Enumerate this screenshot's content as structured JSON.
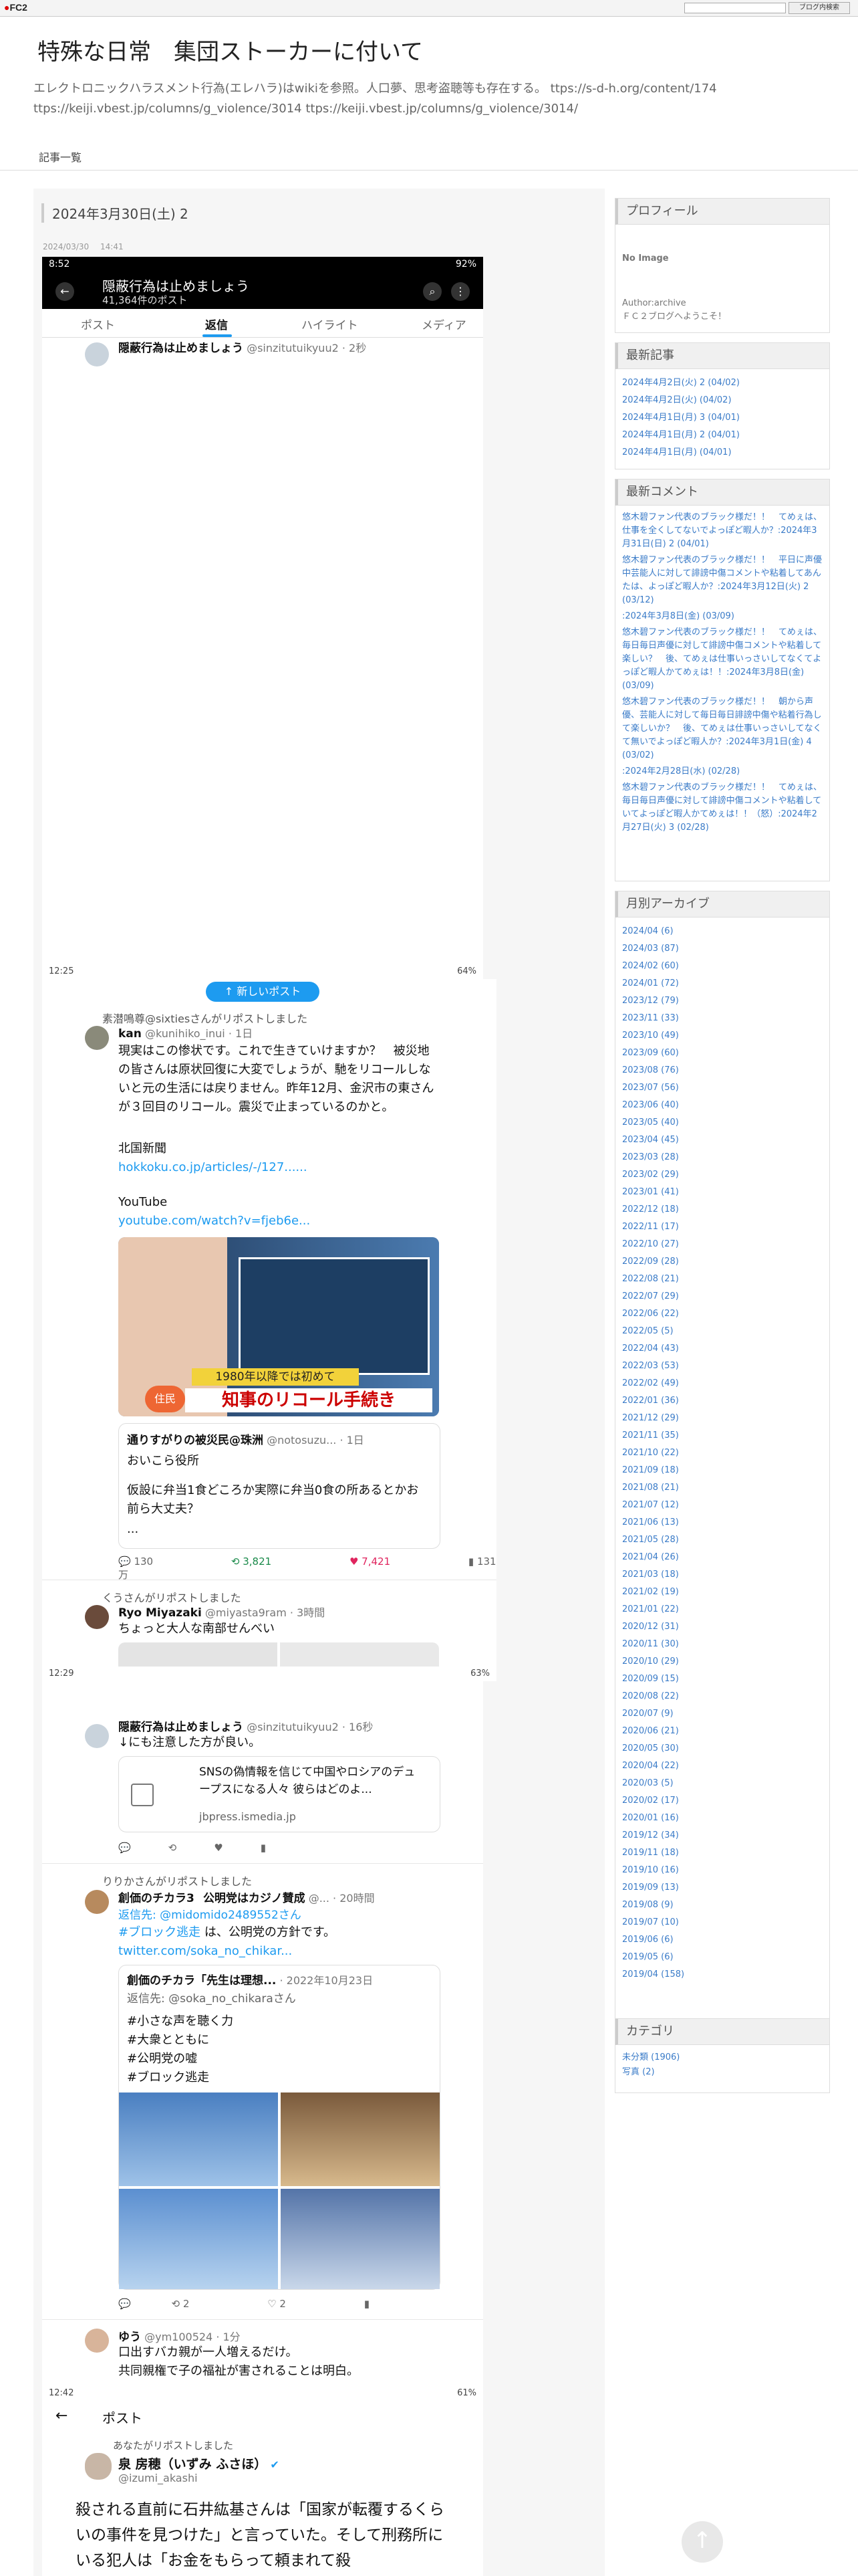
{
  "fc2": {
    "logo": "FC2",
    "blog_btn": "ブログ内検索"
  },
  "blog": {
    "title": "特殊な日常　集団ストーカーに付いて",
    "description": "エレクトロニックハラスメント行為(エレハラ)はwikiを参照。人口夢、思考盗聴等も存在する。 ttps://s-d-h.org/content/174 ttps://keiji.vbest.jp/columns/g_violence/3014 ttps://keiji.vbest.jp/columns/g_violence/3014/",
    "nav_link": "記事一覧"
  },
  "post": {
    "title": "2024年3月30日(土) 2",
    "date": "2024/03/30",
    "time": "14:41"
  },
  "shot1": {
    "status_time": "8:52",
    "status_right": "92%",
    "header_title": "隠蔽行為は止めましょう",
    "header_sub": "41,364件のポスト",
    "tabs": [
      "ポスト",
      "返信",
      "ハイライト",
      "メディア"
    ],
    "tweet_name": "隠蔽行為は止めましょう",
    "tweet_handle": "@sinzitutuikyuu2 · 2秒",
    "bottom_time": "12:25",
    "bottom_right": "64%",
    "new_post": "↑ 新しいポスト"
  },
  "shot2": {
    "rt1": "素潜鳴尊@sixtiesさんがリポストしました",
    "t1_name": "kan",
    "t1_handle": "@kunihiko_inui · 1日",
    "t1_text": "現実はこの惨状です。これで生きていけますか？　被災地の皆さんは原状回復に大変でしょうが、馳をリコールしないと元の生活には戻りません。昨年12月、金沢市の東さんが３回目のリコール。震災で止まっているのかと。",
    "t1_src": "北国新聞",
    "t1_link1": "hokkoku.co.jp/articles/-/127......",
    "t1_yt": "YouTube",
    "t1_link2": "youtube.com/watch?v=fjeb6e...",
    "media_caption1": "1980年以降では初めて",
    "media_caption2": "知事のリコール手続き",
    "media_tag": "住民",
    "quote_name": "通りすがりの被災民@珠洲",
    "quote_handle": "@notosuzu... · 1日",
    "quote_text1": "おいこら役所",
    "quote_text2": "仮設に弁当1食どころか実際に弁当0食の所あるとかお前ら大丈夫？",
    "quote_text3": "...",
    "t1_actions": [
      "130",
      "3,821",
      "7,421",
      "131万"
    ],
    "rt2": "くうさんがリポストしました",
    "t2_name": "Ryo Miyazaki",
    "t2_handle": "@miyasta9ram · 3時間",
    "t2_text": "ちょっと大人な南部せんべい",
    "bottom_time": "12:29",
    "bottom_right": "63%"
  },
  "shot3": {
    "t3_name": "隠蔽行為は止めましょう",
    "t3_handle": "@sinzitutuikyuu2 · 16秒",
    "t3_text": "↓にも注意した方が良い。",
    "card_text": "SNSの偽情報を信じて中国やロシアのデュープスになる人々 彼らはどのよ...",
    "card_domain": "jbpress.ismedia.jp",
    "rt3": "りりかさんがリポストしました",
    "t4_name": "創価のチカラ3",
    "t4_badge": "公明党はカジノ賛成",
    "t4_handle": "@... · 20時間",
    "t4_reply": "返信先: @midomido2489552さん",
    "t4_text_tag": "#ブロック逃走",
    "t4_text": " は、公明党の方針です。",
    "t4_link": "twitter.com/soka_no_chikar...",
    "q_name": "創価のチカラ「先生は理想...",
    "q_date": "· 2022年10月23日",
    "q_reply": "返信先: @soka_no_chikaraさん",
    "q_tags": [
      "#小さな声を聴く力",
      "#大衆とともに",
      "#公明党の嘘",
      "#ブロック逃走"
    ],
    "t4_actions": [
      "2",
      "2"
    ],
    "t5_name": "ゆう",
    "t5_handle": "@ym100524 · 1分",
    "t5_text1": "口出すバカ親が一人増えるだけ。",
    "t5_text2": "共同親権で子の福祉が害されることは明白。",
    "bottom_time": "12:42",
    "bottom_right": "61%"
  },
  "shot4": {
    "header": "ポスト",
    "rt": "あなたがリポストしました",
    "name": "泉 房穂（いずみ ふさほ）",
    "handle": "@izumi_akashi",
    "text": "殺される直前に石井紘基さんは「国家が転覆するくらいの事件を見つけた」と言っていた。そして刑務所にいる犯人は「お金をもらって頼まれて殺"
  },
  "sidebar": {
    "profile_title": "プロフィール",
    "no_image": "No Image",
    "author": "Author:archive",
    "author_desc": "ＦＣ２ブログへようこそ！",
    "recent_title": "最新記事",
    "recent": [
      "2024年4月2日(火) 2 (04/02)",
      "2024年4月2日(火) (04/02)",
      "2024年4月1日(月) 3 (04/01)",
      "2024年4月1日(月) 2 (04/01)",
      "2024年4月1日(月) (04/01)"
    ],
    "comments_title": "最新コメント",
    "comments": [
      "悠木碧ファン代表のブラック様だ！！　てめぇは、仕事を全くしてないでよっぽど暇人か？:2024年3月31日(日) 2 (04/01)",
      "悠木碧ファン代表のブラック様だ！！　平日に声優中芸能人に対して誹謗中傷コメントや粘着してあんたは、よっぽど暇人か？:2024年3月12日(火) 2 (03/12)",
      ":2024年3月8日(金) (03/09)",
      "悠木碧ファン代表のブラック様だ！！　てめぇは、毎日毎日声優に対して誹謗中傷コメントや粘着して楽しい？　後、てめぇは仕事いっさいしてなくてよっぽど暇人かてめぇは！！:2024年3月8日(金) (03/09)",
      "悠木碧ファン代表のブラック様だ！！　朝から声優、芸能人に対して毎日毎日誹謗中傷や粘着行為して楽しいか？　後、てめぇは仕事いっさいしてなくて無いでよっぽど暇人か？:2024年3月1日(金) 4 (03/02)",
      ":2024年2月28日(水) (02/28)",
      "悠木碧ファン代表のブラック様だ！！　てめぇは、毎日毎日声優に対して誹謗中傷コメントや粘着していてよっぽど暇人かてめぇは！！（怒）:2024年2月27日(火) 3 (02/28)"
    ],
    "archive_title": "月別アーカイブ",
    "archive": [
      "2024/04 (6)",
      "2024/03 (87)",
      "2024/02 (60)",
      "2024/01 (72)",
      "2023/12 (79)",
      "2023/11 (33)",
      "2023/10 (49)",
      "2023/09 (60)",
      "2023/08 (76)",
      "2023/07 (56)",
      "2023/06 (40)",
      "2023/05 (40)",
      "2023/04 (45)",
      "2023/03 (28)",
      "2023/02 (29)",
      "2023/01 (41)",
      "2022/12 (18)",
      "2022/11 (17)",
      "2022/10 (27)",
      "2022/09 (28)",
      "2022/08 (21)",
      "2022/07 (29)",
      "2022/06 (22)",
      "2022/05 (5)",
      "2022/04 (43)",
      "2022/03 (53)",
      "2022/02 (49)",
      "2022/01 (36)",
      "2021/12 (29)",
      "2021/11 (35)",
      "2021/10 (22)",
      "2021/09 (18)",
      "2021/08 (21)",
      "2021/07 (12)",
      "2021/06 (13)",
      "2021/05 (28)",
      "2021/04 (26)",
      "2021/03 (18)",
      "2021/02 (19)",
      "2021/01 (22)",
      "2020/12 (31)",
      "2020/11 (30)",
      "2020/10 (29)",
      "2020/09 (15)",
      "2020/08 (22)",
      "2020/07 (9)",
      "2020/06 (21)",
      "2020/05 (30)",
      "2020/04 (22)",
      "2020/03 (5)",
      "2020/02 (17)",
      "2020/01 (16)",
      "2019/12 (34)",
      "2019/11 (18)",
      "2019/10 (16)",
      "2019/09 (13)",
      "2019/08 (9)",
      "2019/07 (10)",
      "2019/06 (6)",
      "2019/05 (6)",
      "2019/04 (158)"
    ],
    "category_title": "カテゴリ",
    "categories": [
      "未分類 (1906)",
      "写真 (2)"
    ]
  }
}
